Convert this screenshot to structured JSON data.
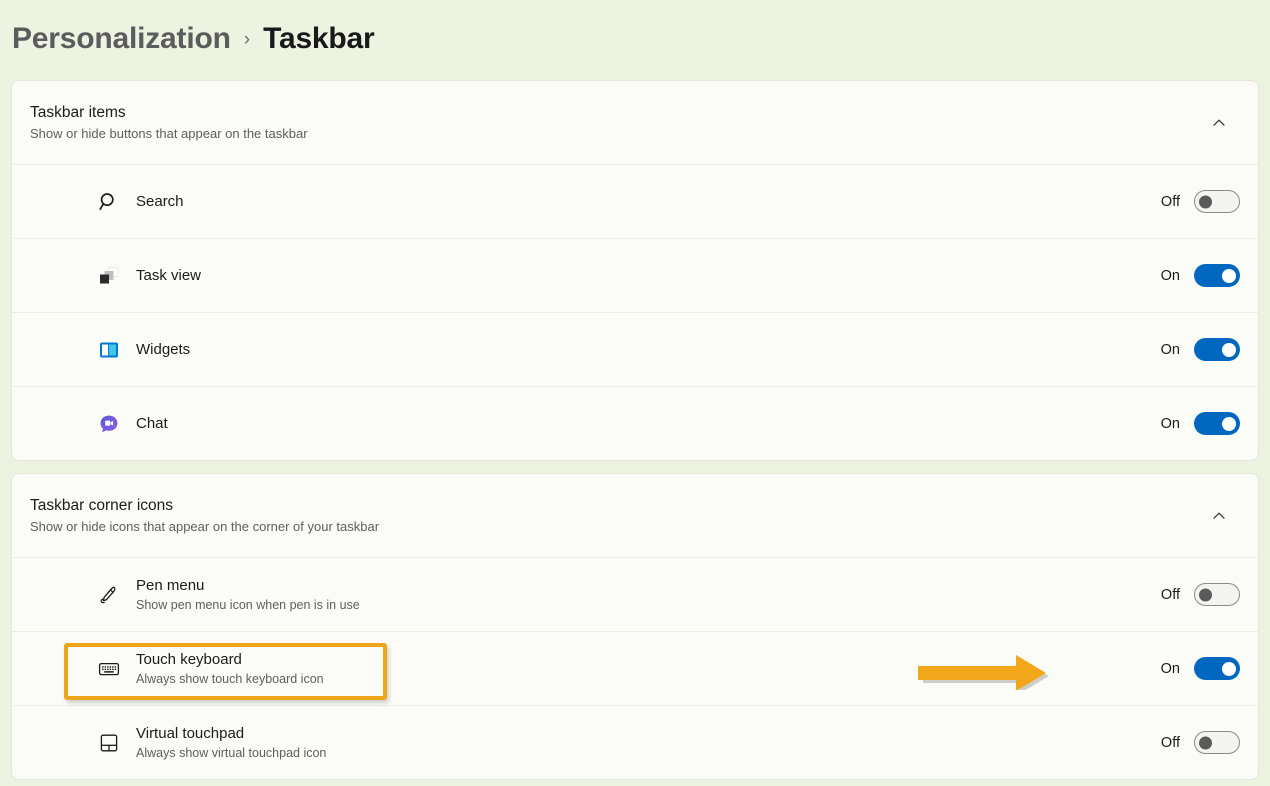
{
  "breadcrumb": {
    "parent": "Personalization",
    "separator": "›",
    "current": "Taskbar"
  },
  "colors": {
    "page_background": "#ECF3E0",
    "card_background": "#FBFCF8",
    "toggle_on": "#0067C0",
    "toggle_off_knob": "#5A5A5A",
    "annotation_orange": "#EDA519",
    "widgets_blue": "#0078D4",
    "widgets_cyan": "#41C5E8",
    "chat_purple": "#6B4FD8"
  },
  "sections": [
    {
      "title": "Taskbar items",
      "subtitle": "Show or hide buttons that appear on the taskbar",
      "collapse_icon": "chevron-up-icon",
      "rows": [
        {
          "icon": "search-icon",
          "label": "Search",
          "sub": "",
          "state": "Off",
          "on": false
        },
        {
          "icon": "task-view-icon",
          "label": "Task view",
          "sub": "",
          "state": "On",
          "on": true
        },
        {
          "icon": "widgets-icon",
          "label": "Widgets",
          "sub": "",
          "state": "On",
          "on": true
        },
        {
          "icon": "chat-icon",
          "label": "Chat",
          "sub": "",
          "state": "On",
          "on": true
        }
      ]
    },
    {
      "title": "Taskbar corner icons",
      "subtitle": "Show or hide icons that appear on the corner of your taskbar",
      "collapse_icon": "chevron-up-icon",
      "rows": [
        {
          "icon": "pen-menu-icon",
          "label": "Pen menu",
          "sub": "Show pen menu icon when pen is in use",
          "state": "Off",
          "on": false
        },
        {
          "icon": "touch-keyboard-icon",
          "label": "Touch keyboard",
          "sub": "Always show touch keyboard icon",
          "state": "On",
          "on": true
        },
        {
          "icon": "virtual-touchpad-icon",
          "label": "Virtual touchpad",
          "sub": "Always show virtual touchpad icon",
          "state": "Off",
          "on": false
        }
      ]
    }
  ],
  "annotations": {
    "highlight_target": "Touch keyboard",
    "arrow_direction": "right",
    "arrow_points_to": "Touch keyboard toggle"
  }
}
